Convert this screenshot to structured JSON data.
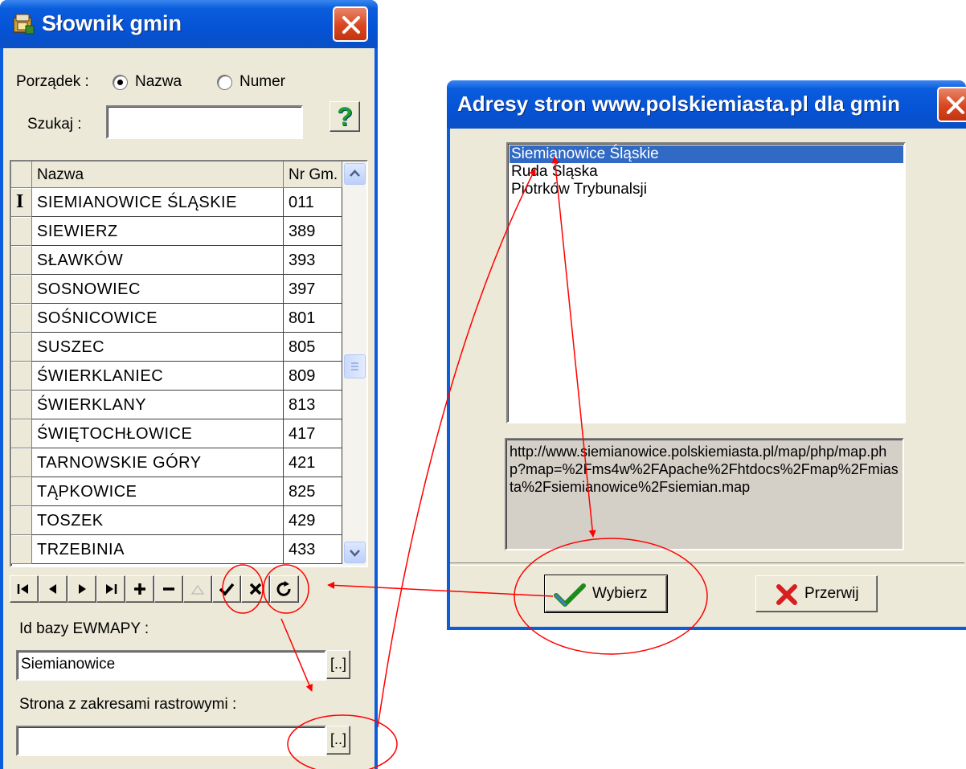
{
  "left_window": {
    "title": "Słownik gmin",
    "order_label": "Porządek :",
    "order_options": [
      "Nazwa",
      "Numer"
    ],
    "order_selected": "Nazwa",
    "search_label": "Szukaj :",
    "search_value": "",
    "help_glyph": "?",
    "columns": [
      "Nazwa",
      "Nr Gm."
    ],
    "current_row_marker": "I",
    "rows": [
      {
        "name": "SIEMIANOWICE ŚLĄSKIE",
        "num": "011"
      },
      {
        "name": "SIEWIERZ",
        "num": "389"
      },
      {
        "name": "SŁAWKÓW",
        "num": "393"
      },
      {
        "name": "SOSNOWIEC",
        "num": "397"
      },
      {
        "name": "SOŚNICOWICE",
        "num": "801"
      },
      {
        "name": "SUSZEC",
        "num": "805"
      },
      {
        "name": "ŚWIERKLANIEC",
        "num": "809"
      },
      {
        "name": "ŚWIERKLANY",
        "num": "813"
      },
      {
        "name": "ŚWIĘTOCHŁOWICE",
        "num": "417"
      },
      {
        "name": "TARNOWSKIE GÓRY",
        "num": "421"
      },
      {
        "name": "TĄPKOWICE",
        "num": "825"
      },
      {
        "name": "TOSZEK",
        "num": "429"
      },
      {
        "name": "TRZEBINIA",
        "num": "433"
      }
    ],
    "navigator_icons": [
      "first-icon",
      "prior-icon",
      "next-icon",
      "last-icon",
      "insert-icon",
      "delete-icon",
      "edit-icon",
      "post-icon",
      "cancel-icon",
      "refresh-icon"
    ],
    "ewmapy_label": "Id bazy EWMAPY :",
    "ewmapy_value": "Siemianowice",
    "raster_label": "Strona z zakresami rastrowymi :",
    "raster_value": "",
    "browse_label": "[..]"
  },
  "right_window": {
    "title": "Adresy stron www.polskiemiasta.pl dla gmin",
    "items": [
      "Siemianowice Śląskie",
      "Ruda Śląska",
      "Piotrków Trybunalsji"
    ],
    "selected_index": 0,
    "url": "http://www.siemianowice.polskiemiasta.pl/map/php/map.php?map=%2Fms4w%2FApache%2Fhtdocs%2Fmap%2Fmiasta%2Fsiemianowice%2Fsiemian.map",
    "ok_label": "Wybierz",
    "cancel_label": "Przerwij"
  },
  "colors": {
    "titlebar": "#0553d6",
    "face": "#ece9d8",
    "selection": "#316ac5",
    "annotation": "#ff0000",
    "close": "#d9461f"
  }
}
